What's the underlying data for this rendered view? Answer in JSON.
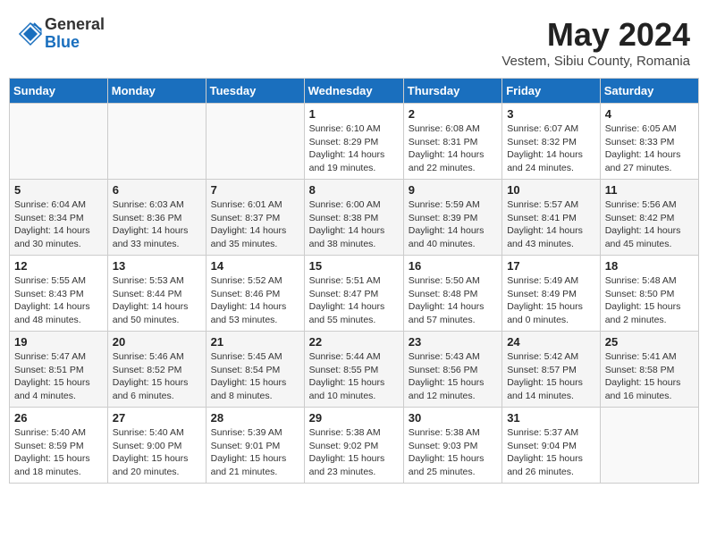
{
  "header": {
    "logo_general": "General",
    "logo_blue": "Blue",
    "month_title": "May 2024",
    "location": "Vestem, Sibiu County, Romania"
  },
  "days_of_week": [
    "Sunday",
    "Monday",
    "Tuesday",
    "Wednesday",
    "Thursday",
    "Friday",
    "Saturday"
  ],
  "weeks": [
    [
      {
        "day": "",
        "info": ""
      },
      {
        "day": "",
        "info": ""
      },
      {
        "day": "",
        "info": ""
      },
      {
        "day": "1",
        "info": "Sunrise: 6:10 AM\nSunset: 8:29 PM\nDaylight: 14 hours\nand 19 minutes."
      },
      {
        "day": "2",
        "info": "Sunrise: 6:08 AM\nSunset: 8:31 PM\nDaylight: 14 hours\nand 22 minutes."
      },
      {
        "day": "3",
        "info": "Sunrise: 6:07 AM\nSunset: 8:32 PM\nDaylight: 14 hours\nand 24 minutes."
      },
      {
        "day": "4",
        "info": "Sunrise: 6:05 AM\nSunset: 8:33 PM\nDaylight: 14 hours\nand 27 minutes."
      }
    ],
    [
      {
        "day": "5",
        "info": "Sunrise: 6:04 AM\nSunset: 8:34 PM\nDaylight: 14 hours\nand 30 minutes."
      },
      {
        "day": "6",
        "info": "Sunrise: 6:03 AM\nSunset: 8:36 PM\nDaylight: 14 hours\nand 33 minutes."
      },
      {
        "day": "7",
        "info": "Sunrise: 6:01 AM\nSunset: 8:37 PM\nDaylight: 14 hours\nand 35 minutes."
      },
      {
        "day": "8",
        "info": "Sunrise: 6:00 AM\nSunset: 8:38 PM\nDaylight: 14 hours\nand 38 minutes."
      },
      {
        "day": "9",
        "info": "Sunrise: 5:59 AM\nSunset: 8:39 PM\nDaylight: 14 hours\nand 40 minutes."
      },
      {
        "day": "10",
        "info": "Sunrise: 5:57 AM\nSunset: 8:41 PM\nDaylight: 14 hours\nand 43 minutes."
      },
      {
        "day": "11",
        "info": "Sunrise: 5:56 AM\nSunset: 8:42 PM\nDaylight: 14 hours\nand 45 minutes."
      }
    ],
    [
      {
        "day": "12",
        "info": "Sunrise: 5:55 AM\nSunset: 8:43 PM\nDaylight: 14 hours\nand 48 minutes."
      },
      {
        "day": "13",
        "info": "Sunrise: 5:53 AM\nSunset: 8:44 PM\nDaylight: 14 hours\nand 50 minutes."
      },
      {
        "day": "14",
        "info": "Sunrise: 5:52 AM\nSunset: 8:46 PM\nDaylight: 14 hours\nand 53 minutes."
      },
      {
        "day": "15",
        "info": "Sunrise: 5:51 AM\nSunset: 8:47 PM\nDaylight: 14 hours\nand 55 minutes."
      },
      {
        "day": "16",
        "info": "Sunrise: 5:50 AM\nSunset: 8:48 PM\nDaylight: 14 hours\nand 57 minutes."
      },
      {
        "day": "17",
        "info": "Sunrise: 5:49 AM\nSunset: 8:49 PM\nDaylight: 15 hours\nand 0 minutes."
      },
      {
        "day": "18",
        "info": "Sunrise: 5:48 AM\nSunset: 8:50 PM\nDaylight: 15 hours\nand 2 minutes."
      }
    ],
    [
      {
        "day": "19",
        "info": "Sunrise: 5:47 AM\nSunset: 8:51 PM\nDaylight: 15 hours\nand 4 minutes."
      },
      {
        "day": "20",
        "info": "Sunrise: 5:46 AM\nSunset: 8:52 PM\nDaylight: 15 hours\nand 6 minutes."
      },
      {
        "day": "21",
        "info": "Sunrise: 5:45 AM\nSunset: 8:54 PM\nDaylight: 15 hours\nand 8 minutes."
      },
      {
        "day": "22",
        "info": "Sunrise: 5:44 AM\nSunset: 8:55 PM\nDaylight: 15 hours\nand 10 minutes."
      },
      {
        "day": "23",
        "info": "Sunrise: 5:43 AM\nSunset: 8:56 PM\nDaylight: 15 hours\nand 12 minutes."
      },
      {
        "day": "24",
        "info": "Sunrise: 5:42 AM\nSunset: 8:57 PM\nDaylight: 15 hours\nand 14 minutes."
      },
      {
        "day": "25",
        "info": "Sunrise: 5:41 AM\nSunset: 8:58 PM\nDaylight: 15 hours\nand 16 minutes."
      }
    ],
    [
      {
        "day": "26",
        "info": "Sunrise: 5:40 AM\nSunset: 8:59 PM\nDaylight: 15 hours\nand 18 minutes."
      },
      {
        "day": "27",
        "info": "Sunrise: 5:40 AM\nSunset: 9:00 PM\nDaylight: 15 hours\nand 20 minutes."
      },
      {
        "day": "28",
        "info": "Sunrise: 5:39 AM\nSunset: 9:01 PM\nDaylight: 15 hours\nand 21 minutes."
      },
      {
        "day": "29",
        "info": "Sunrise: 5:38 AM\nSunset: 9:02 PM\nDaylight: 15 hours\nand 23 minutes."
      },
      {
        "day": "30",
        "info": "Sunrise: 5:38 AM\nSunset: 9:03 PM\nDaylight: 15 hours\nand 25 minutes."
      },
      {
        "day": "31",
        "info": "Sunrise: 5:37 AM\nSunset: 9:04 PM\nDaylight: 15 hours\nand 26 minutes."
      },
      {
        "day": "",
        "info": ""
      }
    ]
  ]
}
